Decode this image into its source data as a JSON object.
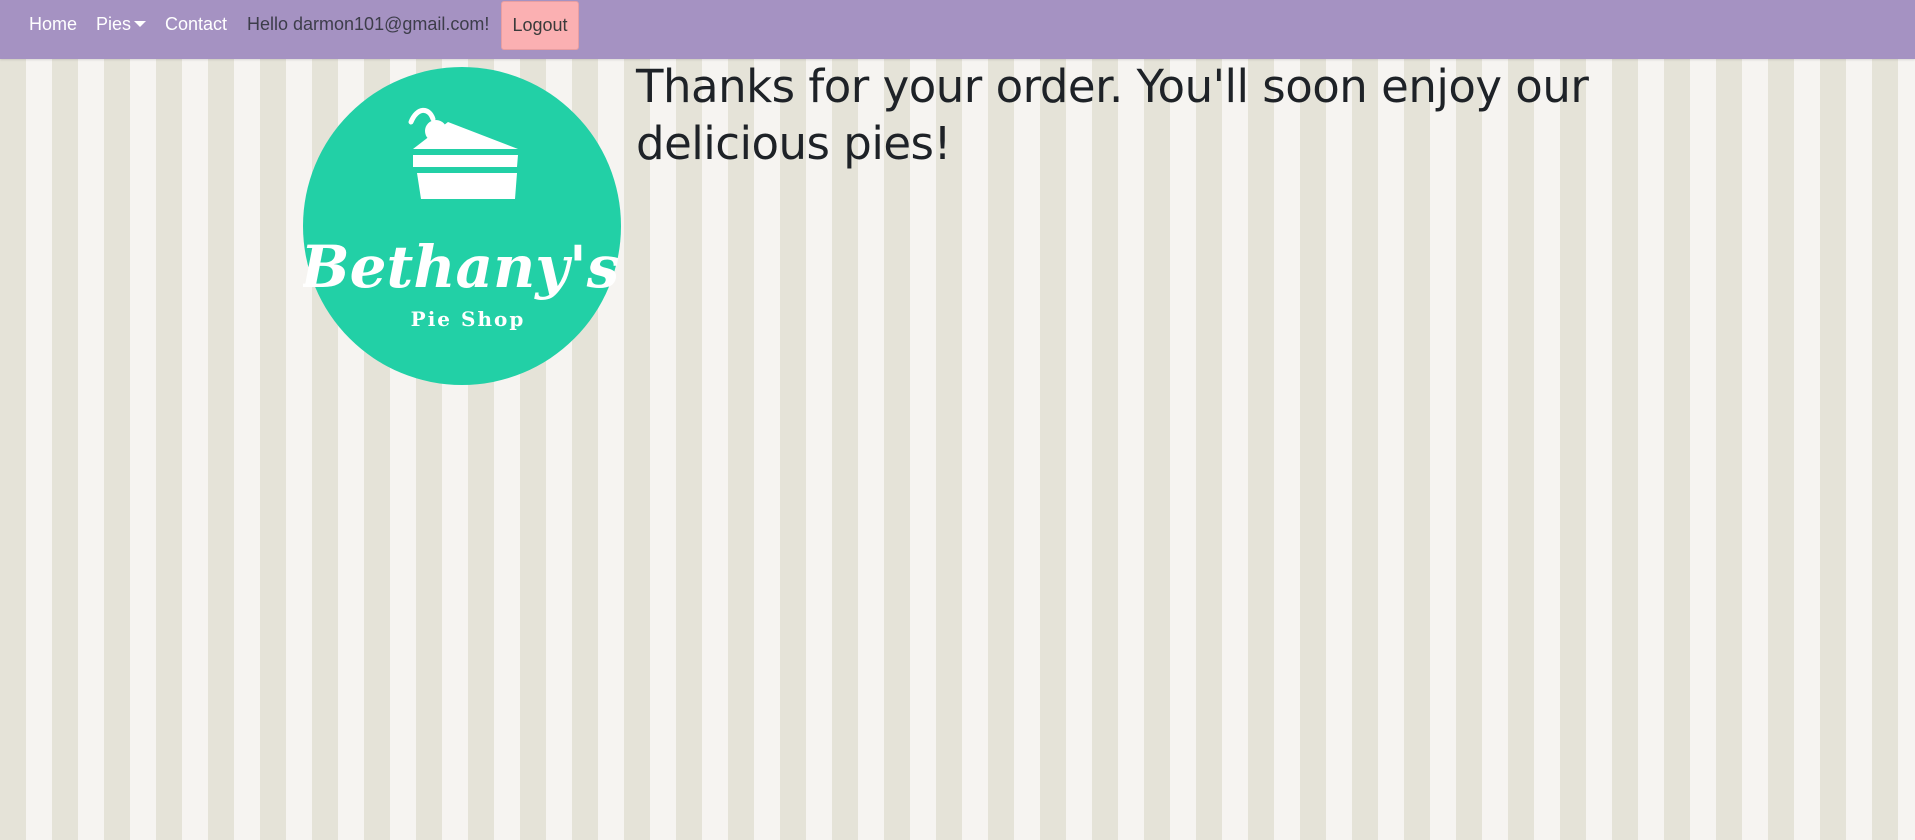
{
  "navbar": {
    "home_label": "Home",
    "pies_label": "Pies",
    "contact_label": "Contact",
    "greeting": "Hello darmon101@gmail.com!",
    "logout_label": "Logout"
  },
  "logo": {
    "brand_text": "Bethany's",
    "sub_text": "Pie Shop",
    "color": "#22d0a6"
  },
  "main": {
    "message": "Thanks for your order. You'll soon enjoy our delicious pies!"
  },
  "colors": {
    "navbar_bg": "#a592c2",
    "logout_bg": "#fbb0b2",
    "stripe_dark": "#e5e3d8",
    "stripe_light": "#f6f4f1"
  }
}
